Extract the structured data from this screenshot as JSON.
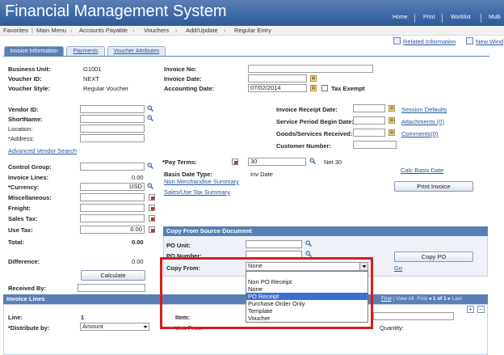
{
  "app": {
    "title": "Financial Management System",
    "top_links": [
      "Home",
      "Print",
      "Worklist",
      "Multi"
    ]
  },
  "breadcrumb": [
    "Favorites",
    "Main Menu",
    "Accounts Payable",
    "Vouchers",
    "Add/Update",
    "Regular Entry"
  ],
  "page_links": {
    "related": "Related Information",
    "new_window": "New Wind"
  },
  "tabs": [
    "Invoice Information",
    "Payments",
    "Voucher Attributes"
  ],
  "header": {
    "business_unit_label": "Business Unit:",
    "business_unit": "G1001",
    "voucher_id_label": "Voucher ID:",
    "voucher_id": "NEXT",
    "voucher_style_label": "Voucher Style:",
    "voucher_style": "Regular Voucher",
    "invoice_no_label": "Invoice No:",
    "invoice_date_label": "Invoice Date:",
    "accounting_date_label": "Accounting Date:",
    "accounting_date": "07/02/2014",
    "tax_exempt_label": "Tax Exempt"
  },
  "vendor": {
    "vendor_id_label": "Vendor ID:",
    "shortname_label": "ShortName:",
    "location_label": "Location:",
    "address_label": "*Address:",
    "search_link": "Advanced Vendor Search"
  },
  "right_fields": {
    "receipt_date_label": "Invoice Receipt Date:",
    "period_begin_label": "Service Period Begin Date:",
    "goods_received_label": "Goods/Services Received:",
    "customer_number_label": "Customer Number:",
    "session_defaults": "Session Defaults",
    "attachments": "Attachments (0)",
    "comments": "Comments(0)"
  },
  "amounts": {
    "control_group_label": "Control Group:",
    "invoice_lines_label": "Invoice Lines:",
    "invoice_lines": "0.00",
    "currency_label": "*Currency:",
    "currency": "USD",
    "misc_label": "Miscellaneous:",
    "freight_label": "Freight:",
    "sales_tax_label": "Sales Tax:",
    "use_tax_label": "Use Tax:",
    "use_tax": "0.00",
    "total_label": "Total:",
    "total": "0.00",
    "difference_label": "Difference:",
    "difference": "0.00",
    "calculate": "Calculate",
    "received_by_label": "Received By:"
  },
  "terms": {
    "pay_terms_label": "*Pay Terms:",
    "pay_terms": "30",
    "pay_terms_desc": "Net 30",
    "basis_date_label": "Basis Date Type:",
    "basis_date": "Inv Date",
    "non_merch": "Non Merchandise Summary",
    "sales_use_tax": "Sales/Use Tax Summary",
    "calc_basis": "Calc Basis Date",
    "print_invoice": "Print Invoice"
  },
  "copy_from": {
    "title": "Copy From Source Document",
    "po_unit_label": "PO Unit:",
    "po_number_label": "PO Number:",
    "copy_from_label": "Copy From:",
    "selected": "None",
    "copy_po": "Copy PO",
    "go": "Go",
    "options": [
      "Non PO Receipt",
      "None",
      "PO Receipt",
      "Purchase Order Only",
      "Template",
      "Voucher"
    ],
    "highlighted": "PO Receipt"
  },
  "invoice_lines": {
    "title": "Invoice Lines",
    "nav_find": "Find",
    "nav_view_all": "View All",
    "nav_first": "First",
    "nav_count": "1 of 1",
    "nav_last": "Last",
    "line_label": "Line:",
    "line": "1",
    "distribute_label": "*Distribute by:",
    "distribute": "Amount",
    "item_label": "Item:",
    "unit_price_label": "Unit Price:",
    "quantity_label": "Quantity:"
  },
  "colors": {
    "banner": "#3f6aa8",
    "link": "#2353a6",
    "highlight": "#3d6fd0",
    "annotation": "#d91d1d"
  }
}
